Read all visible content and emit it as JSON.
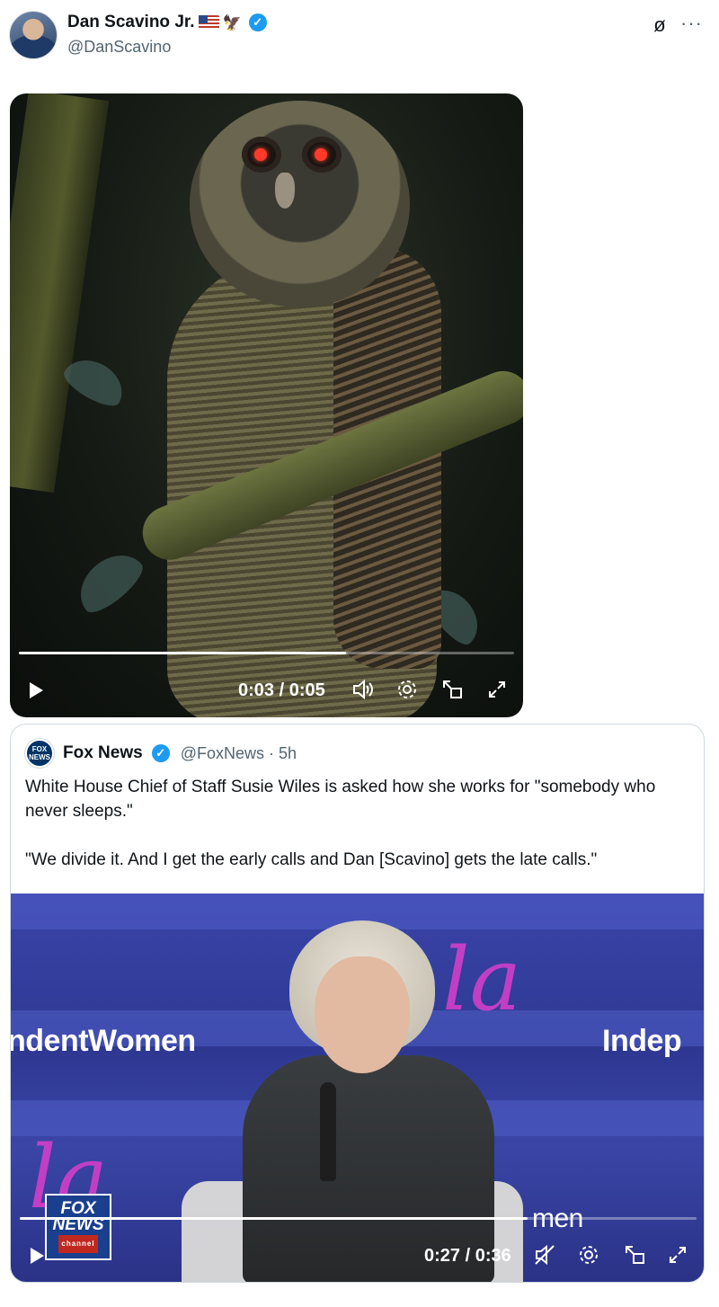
{
  "post": {
    "author_name": "Dan Scavino Jr.",
    "author_emoji": "🦅",
    "author_handle": "@DanScavino"
  },
  "video1": {
    "current_time": "0:03",
    "duration": "0:05",
    "time_display": "0:03 / 0:05",
    "progress_fraction": 0.66
  },
  "quoted_post": {
    "author_name": "Fox News",
    "author_handle": "@FoxNews · 5h",
    "text": "White House Chief of Staff Susie Wiles is asked how she works for \"somebody who never sleeps.\"\n\n\"We divide it. And I get the early calls and Dan [Scavino] gets the late calls.\"",
    "video": {
      "time_display": "0:27 / 0:36",
      "progress_fraction": 0.75,
      "stage_text_left": "ndentWomen",
      "stage_text_right": "Indep",
      "stage_text_bottom": "men",
      "script_top": "la",
      "script_bottom": "la",
      "fox_logo_line1": "FOX",
      "fox_logo_line2": "NEWS",
      "fox_logo_sub": "channel"
    }
  },
  "icons": {
    "verified": "verified-badge-icon",
    "grok": "grok-icon",
    "more": "more-icon",
    "play": "play-icon",
    "volume": "volume-icon",
    "muted": "muted-icon",
    "settings": "settings-icon",
    "pip": "pip-icon",
    "fullscreen": "fullscreen-icon"
  },
  "colors": {
    "verified": "#1d9bf0",
    "text": "#0f1419",
    "muted_text": "#536471",
    "border": "#cfd9de"
  }
}
